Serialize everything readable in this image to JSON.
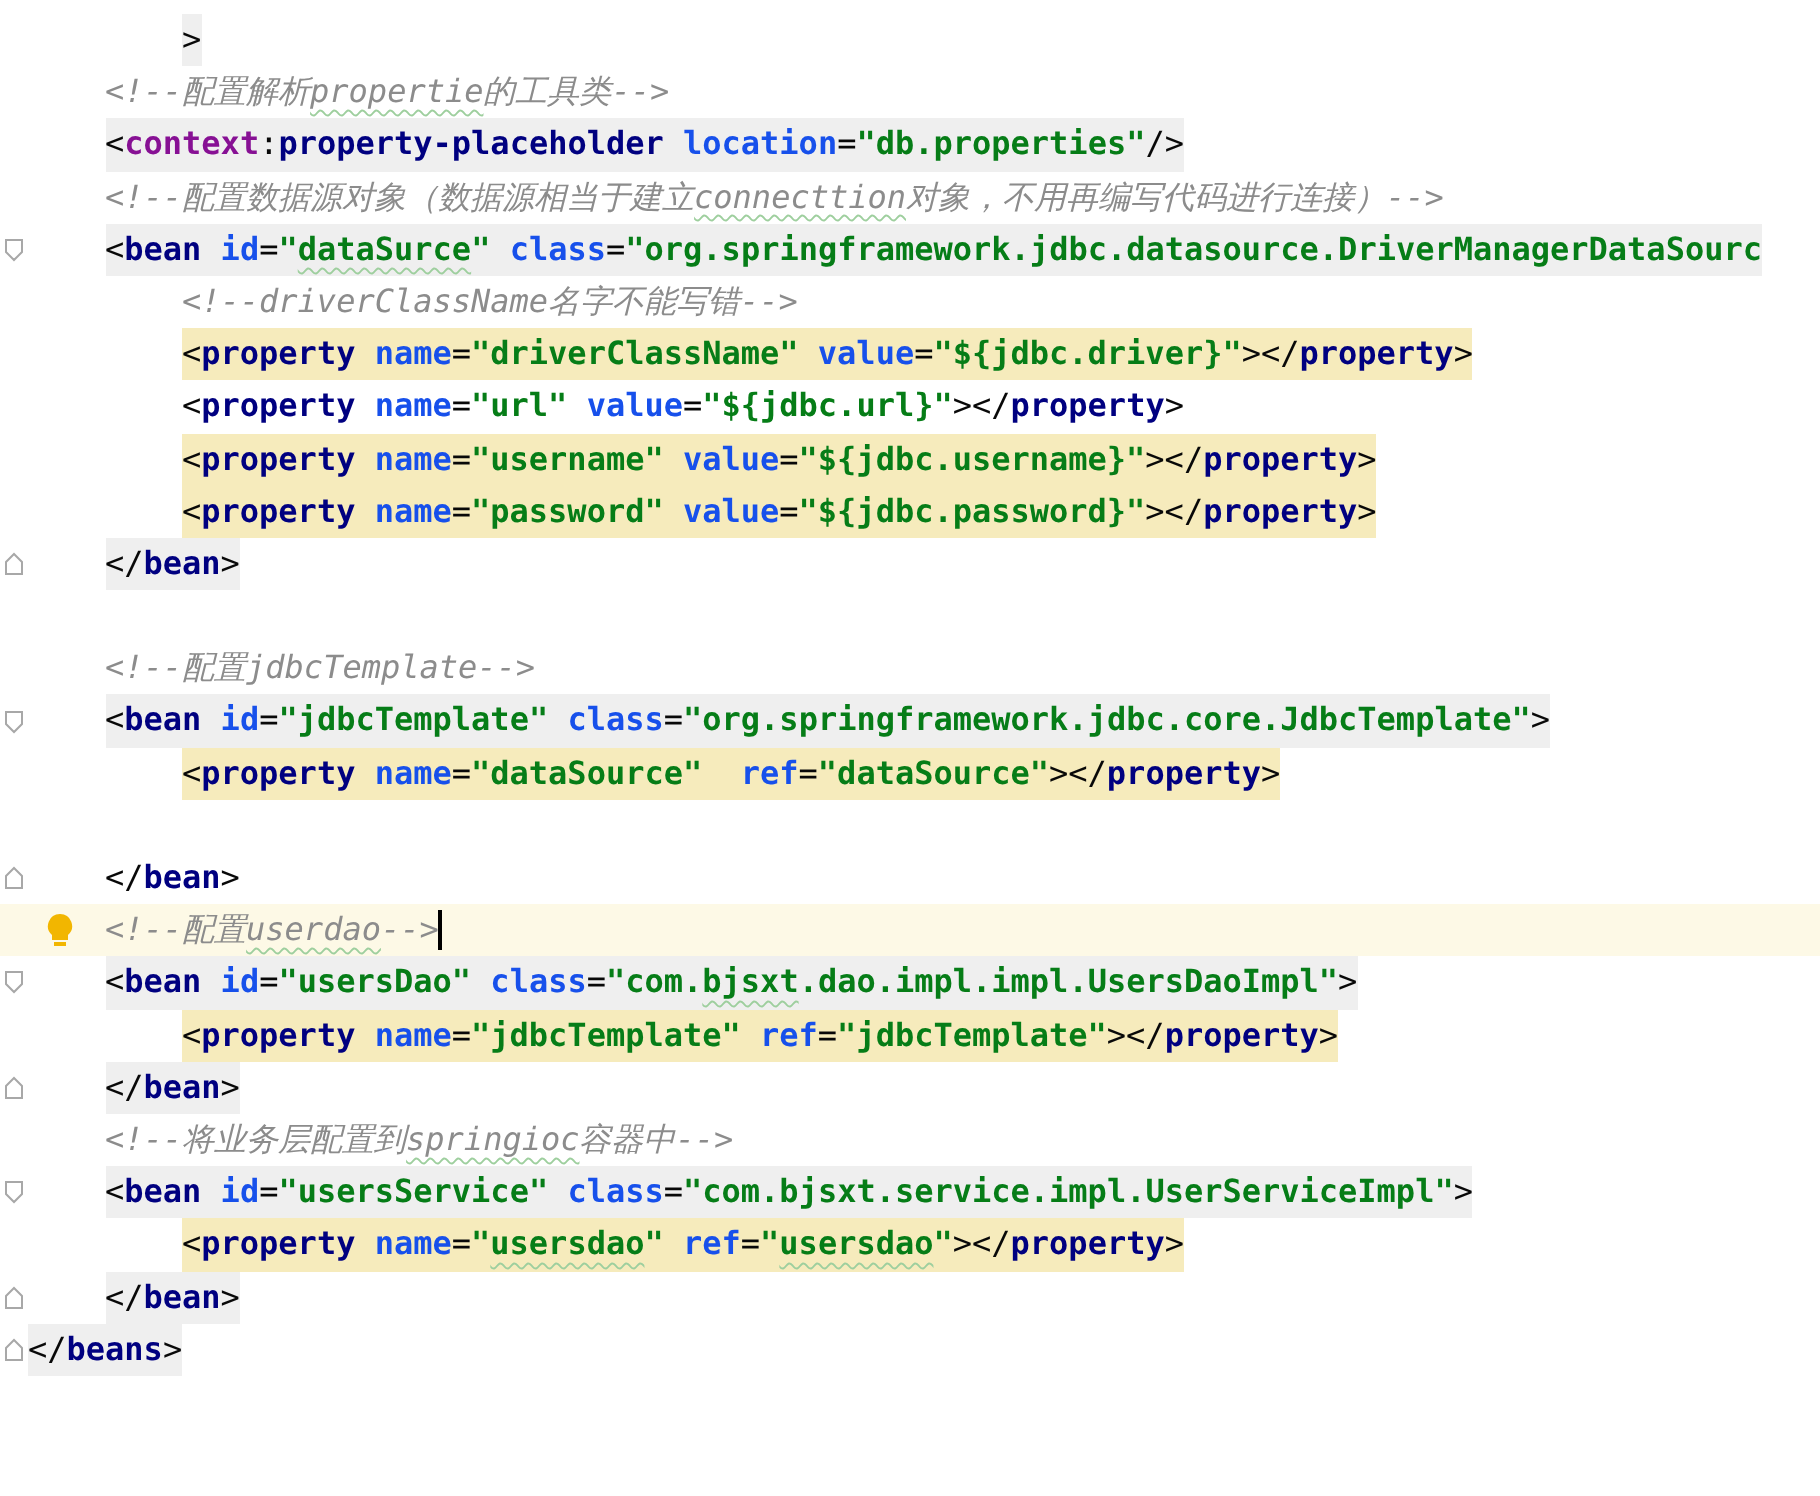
{
  "editor": {
    "continuation": {
      "kind": "element",
      "tag_highlight": true,
      "tokens": [
        {
          "kind": "punct",
          "text": ">"
        }
      ]
    },
    "body": [
      {
        "kind": "comment",
        "tokens": [
          {
            "text": "<!--配置解析"
          },
          {
            "text": "propertie",
            "typo": true
          },
          {
            "text": "的工具类-->"
          }
        ]
      },
      {
        "kind": "element",
        "tag_highlight": true,
        "tokens": [
          {
            "kind": "punct",
            "text": "<"
          },
          {
            "kind": "ns",
            "text": "context"
          },
          {
            "kind": "punct",
            "text": ":"
          },
          {
            "kind": "tag",
            "text": "property-placeholder"
          },
          {
            "kind": "attr",
            "text": " location"
          },
          {
            "kind": "punct",
            "text": "="
          },
          {
            "kind": "value",
            "text": "\"db.properties\""
          },
          {
            "kind": "punct",
            "text": "/>"
          }
        ]
      },
      {
        "kind": "comment",
        "tokens": [
          {
            "text": "<!--配置数据源对象（数据源相当于建立"
          },
          {
            "text": "connecttion",
            "typo": true
          },
          {
            "text": "对象，不用再编写代码进行连接）-->"
          }
        ]
      },
      {
        "kind": "element",
        "tag_highlight": true,
        "fold_open": true,
        "tokens": [
          {
            "kind": "punct",
            "text": "<"
          },
          {
            "kind": "tag",
            "text": "bean"
          },
          {
            "kind": "attr",
            "text": " id"
          },
          {
            "kind": "punct",
            "text": "="
          },
          {
            "kind": "value",
            "text": "\""
          },
          {
            "kind": "value",
            "text": "dataSurce",
            "typo": true
          },
          {
            "kind": "value",
            "text": "\""
          },
          {
            "kind": "attr",
            "text": " class"
          },
          {
            "kind": "punct",
            "text": "="
          },
          {
            "kind": "value",
            "text": "\"org.springframework.jdbc.datasource.DriverManagerDataSourc"
          }
        ],
        "children": [
          {
            "kind": "comment",
            "tokens": [
              {
                "text": "<!--driverClassName名字不能写错-->"
              }
            ]
          },
          {
            "kind": "element",
            "usage_highlight": true,
            "tokens": [
              {
                "kind": "punct",
                "text": "<"
              },
              {
                "kind": "tag",
                "text": "property"
              },
              {
                "kind": "attr",
                "text": " name"
              },
              {
                "kind": "punct",
                "text": "="
              },
              {
                "kind": "value",
                "text": "\"driverClassName\""
              },
              {
                "kind": "attr",
                "text": " value"
              },
              {
                "kind": "punct",
                "text": "="
              },
              {
                "kind": "value",
                "text": "\"${jdbc.driver}\""
              },
              {
                "kind": "punct",
                "text": "></"
              },
              {
                "kind": "tag",
                "text": "property"
              },
              {
                "kind": "punct",
                "text": ">"
              }
            ]
          },
          {
            "kind": "element",
            "tokens": [
              {
                "kind": "punct",
                "text": "<"
              },
              {
                "kind": "tag",
                "text": "property"
              },
              {
                "kind": "attr",
                "text": " name"
              },
              {
                "kind": "punct",
                "text": "="
              },
              {
                "kind": "value",
                "text": "\"url\""
              },
              {
                "kind": "attr",
                "text": " value"
              },
              {
                "kind": "punct",
                "text": "="
              },
              {
                "kind": "value",
                "text": "\"${jdbc.url}\""
              },
              {
                "kind": "punct",
                "text": "></"
              },
              {
                "kind": "tag",
                "text": "property"
              },
              {
                "kind": "punct",
                "text": ">"
              }
            ]
          },
          {
            "kind": "element",
            "usage_highlight": true,
            "tokens": [
              {
                "kind": "punct",
                "text": "<"
              },
              {
                "kind": "tag",
                "text": "property"
              },
              {
                "kind": "attr",
                "text": " name"
              },
              {
                "kind": "punct",
                "text": "="
              },
              {
                "kind": "value",
                "text": "\"username\""
              },
              {
                "kind": "attr",
                "text": " value"
              },
              {
                "kind": "punct",
                "text": "="
              },
              {
                "kind": "value",
                "text": "\"${jdbc.username}\""
              },
              {
                "kind": "punct",
                "text": "></"
              },
              {
                "kind": "tag",
                "text": "property"
              },
              {
                "kind": "punct",
                "text": ">"
              }
            ]
          },
          {
            "kind": "element",
            "usage_highlight": true,
            "tokens": [
              {
                "kind": "punct",
                "text": "<"
              },
              {
                "kind": "tag",
                "text": "property"
              },
              {
                "kind": "attr",
                "text": " name"
              },
              {
                "kind": "punct",
                "text": "="
              },
              {
                "kind": "value",
                "text": "\"password\""
              },
              {
                "kind": "attr",
                "text": " value"
              },
              {
                "kind": "punct",
                "text": "="
              },
              {
                "kind": "value",
                "text": "\"${jdbc.password}\""
              },
              {
                "kind": "punct",
                "text": "></"
              },
              {
                "kind": "tag",
                "text": "property"
              },
              {
                "kind": "punct",
                "text": ">"
              }
            ]
          }
        ],
        "close": {
          "kind": "element",
          "tag_highlight": true,
          "fold_close": true,
          "tokens": [
            {
              "kind": "punct",
              "text": "</"
            },
            {
              "kind": "tag",
              "text": "bean"
            },
            {
              "kind": "punct",
              "text": ">"
            }
          ]
        }
      },
      {
        "kind": "blank"
      },
      {
        "kind": "comment",
        "tokens": [
          {
            "text": "<!--配置jdbcTemplate-->"
          }
        ]
      },
      {
        "kind": "element",
        "tag_highlight": true,
        "fold_open": true,
        "tokens": [
          {
            "kind": "punct",
            "text": "<"
          },
          {
            "kind": "tag",
            "text": "bean"
          },
          {
            "kind": "attr",
            "text": " id"
          },
          {
            "kind": "punct",
            "text": "="
          },
          {
            "kind": "value",
            "text": "\"jdbcTemplate\""
          },
          {
            "kind": "attr",
            "text": " class"
          },
          {
            "kind": "punct",
            "text": "="
          },
          {
            "kind": "value",
            "text": "\"org.springframework.jdbc.core.JdbcTemplate\""
          },
          {
            "kind": "punct",
            "text": ">"
          }
        ],
        "children": [
          {
            "kind": "element",
            "usage_highlight": true,
            "tokens": [
              {
                "kind": "punct",
                "text": "<"
              },
              {
                "kind": "tag",
                "text": "property"
              },
              {
                "kind": "attr",
                "text": " name"
              },
              {
                "kind": "punct",
                "text": "="
              },
              {
                "kind": "value",
                "text": "\"dataSource\""
              },
              {
                "kind": "attr",
                "text": "  ref"
              },
              {
                "kind": "punct",
                "text": "="
              },
              {
                "kind": "value",
                "text": "\"dataSource\""
              },
              {
                "kind": "punct",
                "text": "></"
              },
              {
                "kind": "tag",
                "text": "property"
              },
              {
                "kind": "punct",
                "text": ">"
              }
            ]
          },
          {
            "kind": "blank"
          }
        ],
        "close": {
          "kind": "element",
          "fold_close": true,
          "tokens": [
            {
              "kind": "punct",
              "text": "</"
            },
            {
              "kind": "tag",
              "text": "bean"
            },
            {
              "kind": "punct",
              "text": ">"
            }
          ]
        }
      },
      {
        "kind": "comment",
        "current": true,
        "tokens": [
          {
            "text": "<!--配置"
          },
          {
            "text": "userdao",
            "typo": true
          },
          {
            "text": "-->"
          }
        ]
      },
      {
        "kind": "element",
        "tag_highlight": true,
        "fold_open": true,
        "tokens": [
          {
            "kind": "punct",
            "text": "<"
          },
          {
            "kind": "tag",
            "text": "bean"
          },
          {
            "kind": "attr",
            "text": " id"
          },
          {
            "kind": "punct",
            "text": "="
          },
          {
            "kind": "value",
            "text": "\"usersDao\""
          },
          {
            "kind": "attr",
            "text": " class"
          },
          {
            "kind": "punct",
            "text": "="
          },
          {
            "kind": "value",
            "text": "\"com."
          },
          {
            "kind": "value",
            "text": "bjsxt",
            "typo": true
          },
          {
            "kind": "value",
            "text": ".dao.impl.impl.UsersDaoImpl\""
          },
          {
            "kind": "punct",
            "text": ">"
          }
        ],
        "children": [
          {
            "kind": "element",
            "usage_highlight": true,
            "tokens": [
              {
                "kind": "punct",
                "text": "<"
              },
              {
                "kind": "tag",
                "text": "property"
              },
              {
                "kind": "attr",
                "text": " name"
              },
              {
                "kind": "punct",
                "text": "="
              },
              {
                "kind": "value",
                "text": "\"jdbcTemplate\""
              },
              {
                "kind": "attr",
                "text": " ref"
              },
              {
                "kind": "punct",
                "text": "="
              },
              {
                "kind": "value",
                "text": "\"jdbcTemplate\""
              },
              {
                "kind": "punct",
                "text": "></"
              },
              {
                "kind": "tag",
                "text": "property"
              },
              {
                "kind": "punct",
                "text": ">"
              }
            ]
          }
        ],
        "close": {
          "kind": "element",
          "tag_highlight": true,
          "fold_close": true,
          "tokens": [
            {
              "kind": "punct",
              "text": "</"
            },
            {
              "kind": "tag",
              "text": "bean"
            },
            {
              "kind": "punct",
              "text": ">"
            }
          ]
        }
      },
      {
        "kind": "comment",
        "tokens": [
          {
            "text": "<!--将业务层配置到"
          },
          {
            "text": "springioc",
            "typo": true
          },
          {
            "text": "容器中-->"
          }
        ]
      },
      {
        "kind": "element",
        "tag_highlight": true,
        "fold_open": true,
        "tokens": [
          {
            "kind": "punct",
            "text": "<"
          },
          {
            "kind": "tag",
            "text": "bean"
          },
          {
            "kind": "attr",
            "text": " id"
          },
          {
            "kind": "punct",
            "text": "="
          },
          {
            "kind": "value",
            "text": "\"usersService\""
          },
          {
            "kind": "attr",
            "text": " class"
          },
          {
            "kind": "punct",
            "text": "="
          },
          {
            "kind": "value",
            "text": "\"com.bjsxt.service.impl.UserServiceImpl\""
          },
          {
            "kind": "punct",
            "text": ">"
          }
        ],
        "children": [
          {
            "kind": "element",
            "usage_highlight": true,
            "tokens": [
              {
                "kind": "punct",
                "text": "<"
              },
              {
                "kind": "tag",
                "text": "property"
              },
              {
                "kind": "attr",
                "text": " name"
              },
              {
                "kind": "punct",
                "text": "="
              },
              {
                "kind": "value",
                "text": "\""
              },
              {
                "kind": "value",
                "text": "usersdao",
                "typo": true
              },
              {
                "kind": "value",
                "text": "\""
              },
              {
                "kind": "attr",
                "text": " ref"
              },
              {
                "kind": "punct",
                "text": "="
              },
              {
                "kind": "value",
                "text": "\""
              },
              {
                "kind": "value",
                "text": "usersdao",
                "typo": true
              },
              {
                "kind": "value",
                "text": "\""
              },
              {
                "kind": "punct",
                "text": "></"
              },
              {
                "kind": "tag",
                "text": "property"
              },
              {
                "kind": "punct",
                "text": ">"
              }
            ]
          }
        ],
        "close": {
          "kind": "element",
          "tag_highlight": true,
          "fold_close": true,
          "tokens": [
            {
              "kind": "punct",
              "text": "</"
            },
            {
              "kind": "tag",
              "text": "bean"
            },
            {
              "kind": "punct",
              "text": ">"
            }
          ]
        }
      }
    ],
    "closing": {
      "kind": "element",
      "tag_highlight": true,
      "fold_close": true,
      "tokens": [
        {
          "kind": "punct",
          "text": "</"
        },
        {
          "kind": "tag",
          "text": "beans"
        },
        {
          "kind": "punct",
          "text": ">"
        }
      ]
    }
  }
}
